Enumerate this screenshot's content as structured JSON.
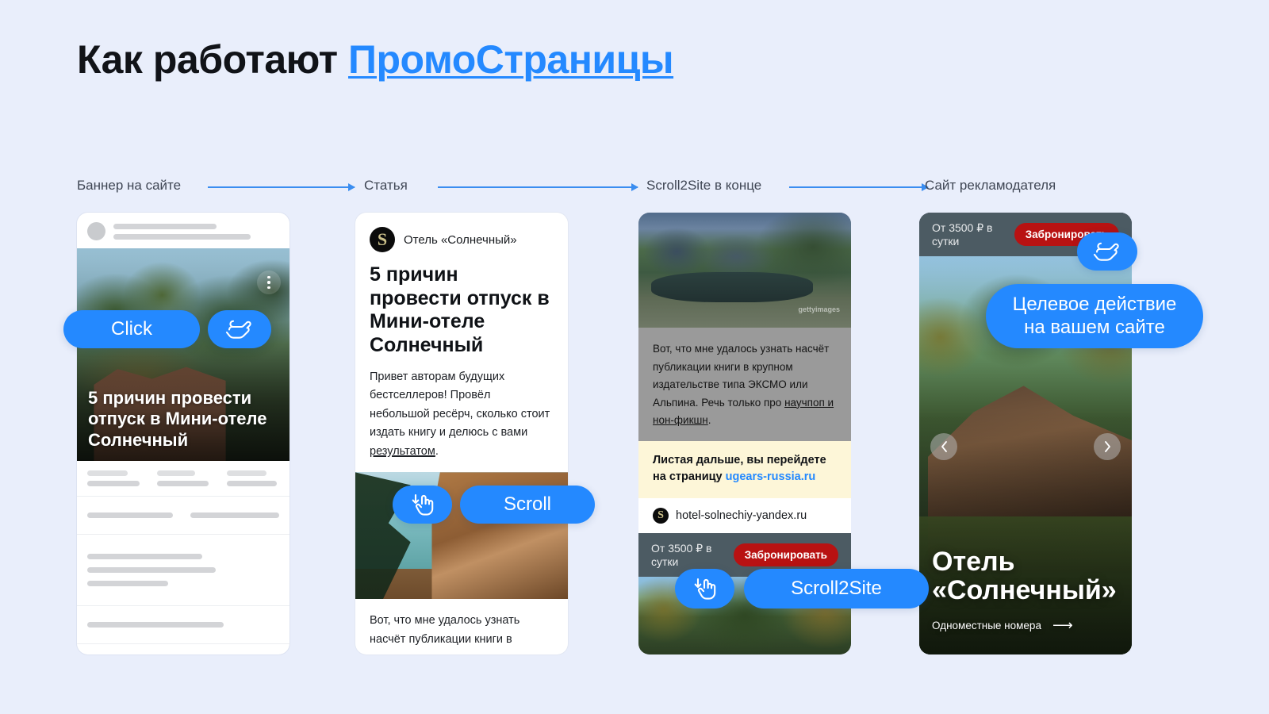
{
  "title": {
    "plain": "Как работают ",
    "accent": "ПромоСтраницы"
  },
  "steps": [
    {
      "label": "Баннер на сайте"
    },
    {
      "label": "Статья"
    },
    {
      "label": "Scroll2Site в конце"
    },
    {
      "label": "Сайт рекламодателя"
    }
  ],
  "colors": {
    "background": "#e9eefb",
    "accent_blue": "#2489ff",
    "arrow_blue": "#3a8df0",
    "book_red": "#b81212",
    "notice_yellow": "#fdf6d8",
    "logo_gold": "#ccc18a"
  },
  "phone1": {
    "headline": "5 причин провести отпуск в Мини-отеле Солнечный",
    "kebab_icon": "kebab-menu-icon",
    "pill_click": "Click",
    "hand_icon": "tap-hand-icon"
  },
  "phone2": {
    "brand": "Отель «Солнечный»",
    "logo_letter": "S",
    "headline": "5 причин провести отпуск в Мини-отеле Солнечный",
    "body_before_link": "Привет авторам будущих бестселлеров! Провёл небольшой ресёрч, сколько стоит издать книгу и делюсь с вами ",
    "body_link": "результатом",
    "body_after_link": ".",
    "body2": "Вот, что мне удалось узнать насчёт публикации книги в крупном издательстве типа ЭКСМО или Альпина. Речь только",
    "pill_scroll": "Scroll",
    "hand_icon": "scroll-down-hand-icon"
  },
  "phone3": {
    "text_before_link": "Вот, что мне удалось узнать насчёт публикации книги в крупном издательстве типа ЭКСМО или Альпина. Речь только про ",
    "text_link": "научпоп и нон-фикшн",
    "text_after_link": ".",
    "notice_line1": "Листая дальше, вы перейдете",
    "notice_line2_prefix": "на страницу ",
    "notice_link": "ugears-russia.ru",
    "url": "hotel-solnechiy-yandex.ru",
    "logo_letter": "S",
    "price": "От 3500 ₽ в сутки",
    "book_button": "Забронировать",
    "pill_scroll2site": "Scroll2Site",
    "hand_icon": "scroll-down-hand-icon",
    "photo_watermark": "gettyimages"
  },
  "phone4": {
    "price": "От 3500 ₽ в сутки",
    "book_button": "Забронировать",
    "hand_icon": "tap-hand-icon",
    "pill_line1": "Целевое действие",
    "pill_line2": "на вашем сайте",
    "hero_title_line1": "Отель",
    "hero_title_line2": "«Солнечный»",
    "hero_sub": "Одноместные номера",
    "hero_sub_arrow": "⟶",
    "prev_icon": "chevron-left-icon",
    "next_icon": "chevron-right-icon"
  }
}
